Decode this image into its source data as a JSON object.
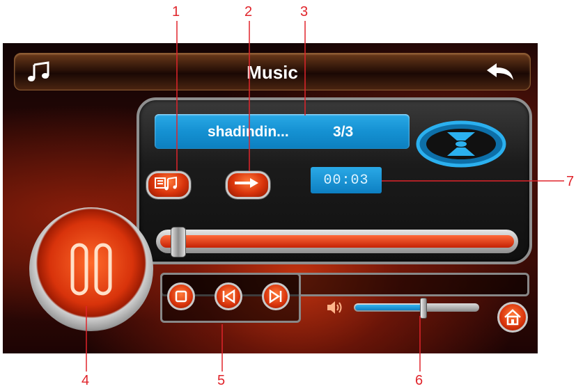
{
  "callouts": [
    "1",
    "2",
    "3",
    "4",
    "5",
    "6",
    "7"
  ],
  "app": {
    "title": "Music",
    "song_title": "shadindin...",
    "track_count": "3/3",
    "elapsed_time": "00:03",
    "progress_fraction": 0.03,
    "volume_fraction": 0.55
  },
  "icons": [
    "music-note-icon",
    "back-arrow-icon",
    "playlist-icon",
    "repeat-arrow-icon",
    "disc-icon",
    "pause-icon",
    "stop-icon",
    "previous-icon",
    "next-icon",
    "volume-icon",
    "home-icon"
  ],
  "colors": {
    "accent_orange": "#d8330b",
    "accent_blue": "#1591d2",
    "callout_red": "#e0242b"
  }
}
